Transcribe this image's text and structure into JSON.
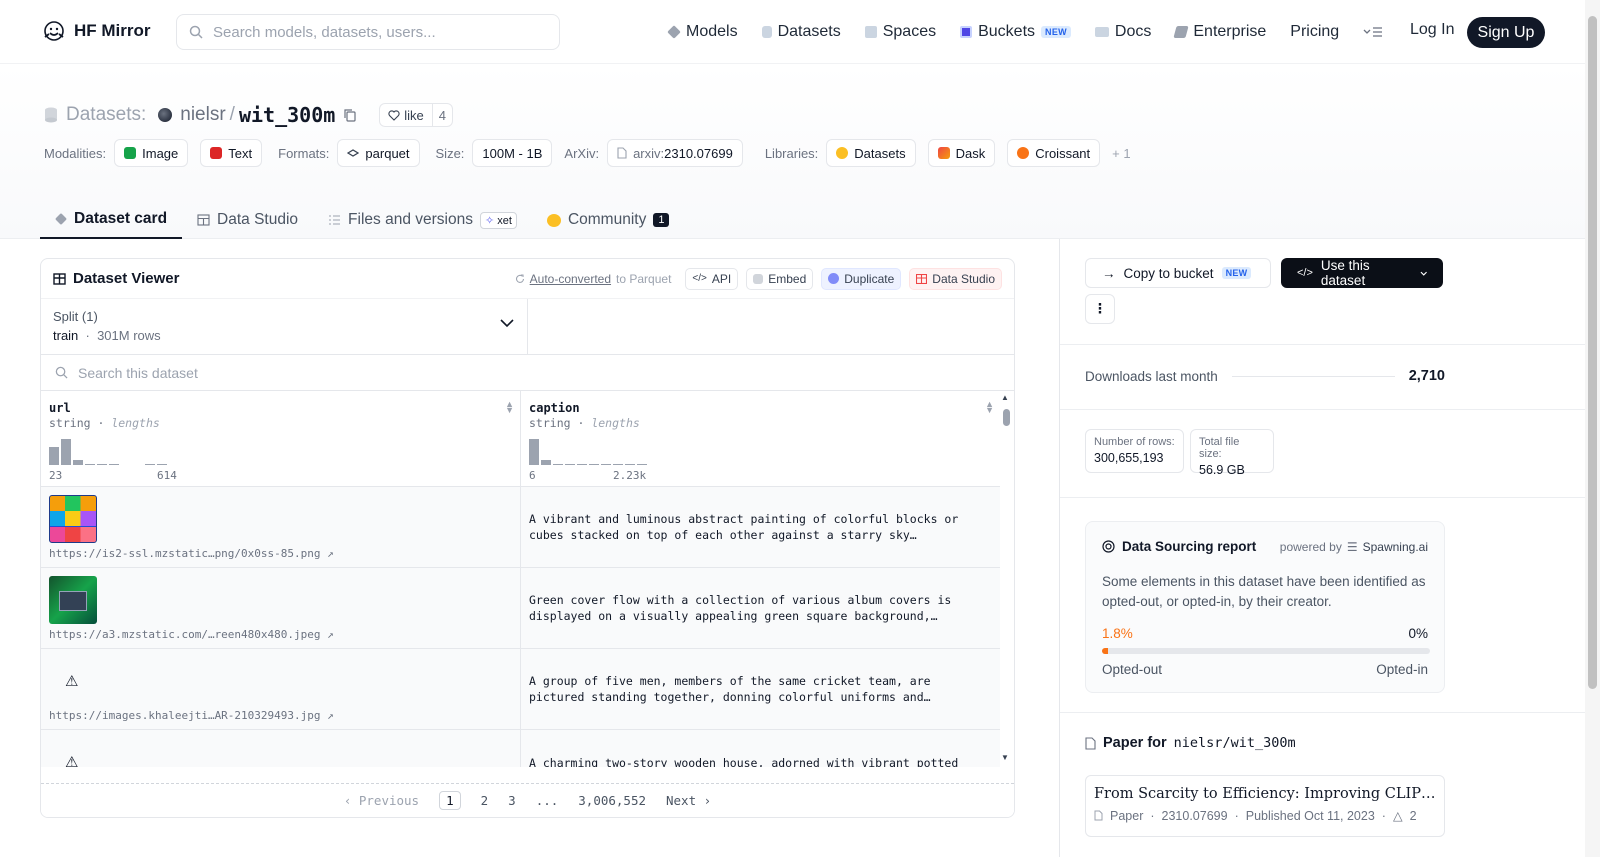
{
  "topnav": {
    "brand": "HF Mirror",
    "search_placeholder": "Search models, datasets, users...",
    "items": [
      {
        "label": "Models",
        "color": "#6b7280"
      },
      {
        "label": "Datasets",
        "color": "#9ca3af"
      },
      {
        "label": "Spaces",
        "color": "#9ca3af"
      },
      {
        "label": "Buckets",
        "color": "#4f46e5",
        "badge": "NEW"
      },
      {
        "label": "Docs",
        "color": "#9ca3af"
      },
      {
        "label": "Enterprise",
        "color": "#6b7280"
      },
      {
        "label": "Pricing"
      }
    ],
    "login": "Log In",
    "signup": "Sign Up"
  },
  "header": {
    "label": "Datasets:",
    "owner": "nielsr",
    "separator": "/",
    "name": "wit_300m",
    "like_label": "like",
    "like_count": "4",
    "meta": {
      "modalities_label": "Modalities:",
      "modalities": [
        "Image",
        "Text"
      ],
      "formats_label": "Formats:",
      "format": "parquet",
      "size_label": "Size:",
      "size": "100M - 1B",
      "arxiv_label": "ArXiv:",
      "arxiv_prefix": "arxiv:",
      "arxiv": "2310.07699",
      "libraries_label": "Libraries:",
      "libraries": [
        "Datasets",
        "Dask",
        "Croissant"
      ],
      "libraries_more": "+ 1"
    },
    "tabs": [
      {
        "label": "Dataset card",
        "active": true
      },
      {
        "label": "Data Studio"
      },
      {
        "label": "Files and versions",
        "badge": "xet"
      },
      {
        "label": "Community",
        "count": "1"
      }
    ]
  },
  "viewer": {
    "title": "Dataset Viewer",
    "auto_converted": "Auto-converted",
    "to_parquet": "to Parquet",
    "api": "API",
    "embed": "Embed",
    "duplicate": "Duplicate",
    "data_studio": "Data Studio",
    "split_label": "Split (1)",
    "split_name": "train",
    "split_rows": "301M rows",
    "search_placeholder": "Search this dataset",
    "columns": [
      {
        "name": "url",
        "type": "string",
        "stat": "lengths",
        "min": "23",
        "max": "614"
      },
      {
        "name": "caption",
        "type": "string",
        "stat": "lengths",
        "min": "6",
        "max": "2.23k"
      }
    ],
    "rows": [
      {
        "url": "https://is2-ssl.mzstatic…png/0x0ss-85.png ↗",
        "caption": "A vibrant and luminous abstract painting of colorful blocks or cubes stacked on top of each other against a starry sky…",
        "thumb": "blocks"
      },
      {
        "url": "https://a3.mzstatic.com/…reen480x480.jpeg ↗",
        "caption": "Green cover flow with a collection of various album covers is displayed on a visually appealing green square background,…",
        "thumb": "green"
      },
      {
        "url": "https://images.khaleejti…AR-210329493.jpg ↗",
        "caption": "A group of five men, members of the same cricket team, are pictured standing together, donning colorful uniforms and…",
        "thumb": "broken"
      },
      {
        "url": "",
        "caption": "A charming two-story wooden house, adorned with vibrant potted",
        "thumb": "broken"
      }
    ],
    "pager": {
      "prev": "Previous",
      "pages": [
        "1",
        "2",
        "3",
        "...",
        "3,006,552"
      ],
      "next": "Next"
    }
  },
  "sidebar": {
    "copy_bucket": "Copy to bucket",
    "copy_badge": "NEW",
    "use_dataset": "Use this dataset",
    "downloads_label": "Downloads last month",
    "downloads": "2,710",
    "rows_label": "Number of rows:",
    "rows": "300,655,193",
    "filesize_label": "Total file size:",
    "filesize": "56.9 GB",
    "dsr": {
      "title": "Data Sourcing report",
      "powered_by": "powered by",
      "provider": "Spawning.ai",
      "text": "Some elements in this dataset have been identified as opted-out, or opted-in, by their creator.",
      "opted_out_pct": "1.8%",
      "opted_in_pct": "0%",
      "opted_out_fraction": 0.018,
      "opted_out_label": "Opted-out",
      "opted_in_label": "Opted-in"
    },
    "paper": {
      "heading": "Paper for",
      "repo": "nielsr/wit_300m",
      "title": "From Scarcity to Efficiency: Improving CLIP Training via Visual-enriched Captions",
      "kind": "Paper",
      "id": "2310.07699",
      "published": "Published Oct 11, 2023",
      "upvotes": "2"
    }
  },
  "colors": {
    "accent_orange": "#f97316",
    "dark": "#111827"
  }
}
